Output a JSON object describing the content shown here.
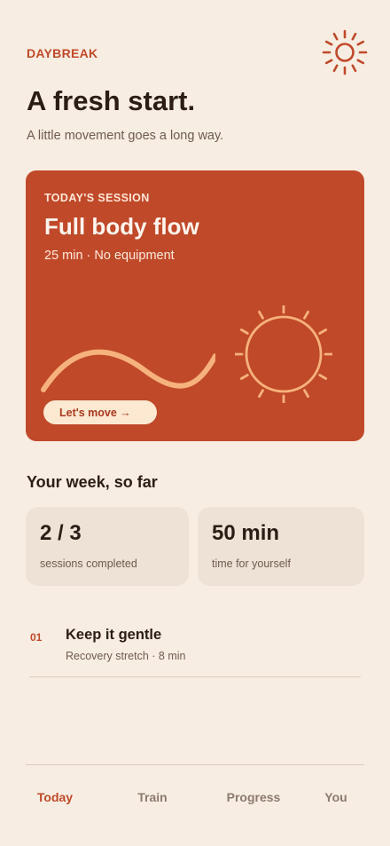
{
  "app": {
    "brand": "DAYBREAK"
  },
  "icons": {
    "logo": "sun-icon",
    "hero_art": [
      "wave-line",
      "sun-icon"
    ]
  },
  "colors": {
    "accent": "#c0492a",
    "background": "#f8ede2",
    "card": "#ede2d5",
    "art": "#f6b27c"
  },
  "hero": {
    "headline": "A fresh start.",
    "subline": "A little movement goes a long way."
  },
  "session": {
    "kicker": "TODAY'S SESSION",
    "title": "Full body flow",
    "meta": "25 min · No equipment",
    "cta": "Let's move →"
  },
  "week": {
    "title": "Your week, so far",
    "stats": [
      {
        "value": "2 / 3",
        "label": "sessions completed"
      },
      {
        "value": "50 min",
        "label": "time for yourself"
      }
    ]
  },
  "plan": [
    {
      "number": "01",
      "title": "Keep it gentle",
      "meta": "Recovery stretch · 8 min"
    }
  ],
  "tabs": [
    {
      "label": "Today",
      "active": true
    },
    {
      "label": "Train",
      "active": false
    },
    {
      "label": "Progress",
      "active": false
    },
    {
      "label": "You",
      "active": false
    }
  ]
}
